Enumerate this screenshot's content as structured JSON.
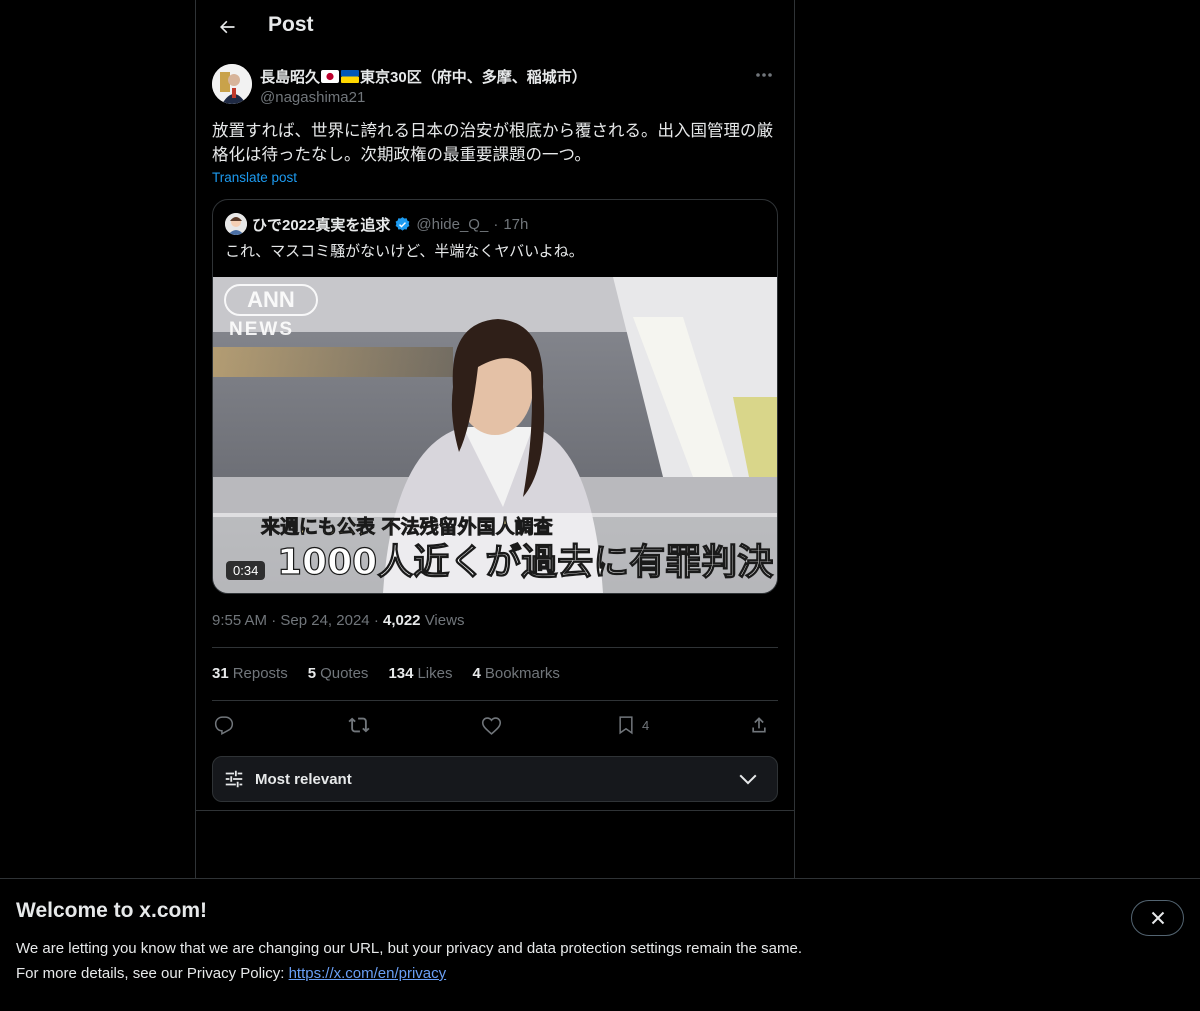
{
  "header": {
    "title": "Post"
  },
  "author": {
    "name": "長島昭久",
    "name_suffix": "東京30区（府中、多摩、稲城市）",
    "handle": "@nagashima21"
  },
  "post": {
    "text": "放置すれば、世界に誇れる日本の治安が根底から覆される。出入国管理の厳格化は待ったなし。次期政権の最重要課題の一つ。",
    "translate_label": "Translate post"
  },
  "quote": {
    "name": "ひで2022真実を追求",
    "handle": "@hide_Q_",
    "separator": "·",
    "time": "17h",
    "text": "これ、マスコミ騒がないけど、半端なくヤバいよね。",
    "video": {
      "logo_top": "ANN",
      "logo_bottom": "NEWS",
      "caption_small": "来週にも公表  不法残留外国人調査",
      "caption_large": "1000人近くが過去に有罪判決",
      "duration": "0:34"
    }
  },
  "meta": {
    "time": "9:55 AM",
    "dot1": "·",
    "date": "Sep 24, 2024",
    "dot2": "·",
    "views_count": "4,022",
    "views_label": "Views"
  },
  "stats": [
    {
      "count": "31",
      "label": "Reposts"
    },
    {
      "count": "5",
      "label": "Quotes"
    },
    {
      "count": "134",
      "label": "Likes"
    },
    {
      "count": "4",
      "label": "Bookmarks"
    }
  ],
  "actions": {
    "bookmark_count": "4"
  },
  "sort": {
    "label": "Most relevant"
  },
  "banner": {
    "title": "Welcome to x.com!",
    "line1": "We are letting you know that we are changing our URL, but your privacy and data protection settings remain the same.",
    "line2_prefix": "For more details, see our Privacy Policy: ",
    "link": "https://x.com/en/privacy"
  },
  "colors": {
    "background": "#000000",
    "text": "#e7e9ea",
    "muted": "#71767b",
    "accent": "#1d9bf0",
    "border": "#2f3336"
  },
  "icons": [
    "back-arrow-icon",
    "more-icon",
    "verified-badge-icon",
    "reply-icon",
    "repost-icon",
    "like-icon",
    "bookmark-icon",
    "share-icon",
    "filter-icon",
    "chevron-down-icon",
    "close-icon"
  ]
}
